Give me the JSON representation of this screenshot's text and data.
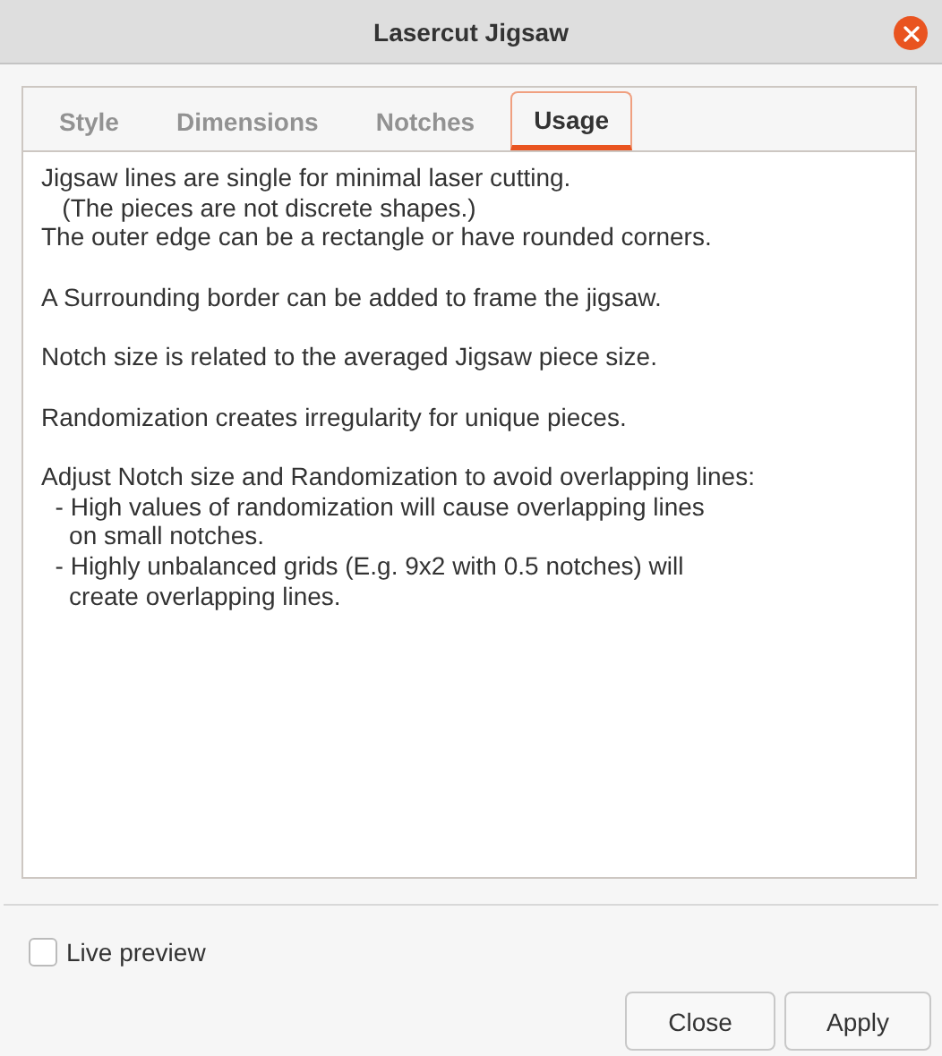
{
  "window": {
    "title": "Lasercut Jigsaw"
  },
  "tabs": [
    {
      "label": "Style",
      "selected": false
    },
    {
      "label": "Dimensions",
      "selected": false
    },
    {
      "label": "Notches",
      "selected": false
    },
    {
      "label": "Usage",
      "selected": true
    }
  ],
  "usage_text": [
    [
      "Jigsaw lines are single for minimal laser cutting.",
      "   (The pieces are not discrete shapes.)",
      "The outer edge can be a rectangle or have rounded corners."
    ],
    [
      "A Surrounding border can be added to frame the jigsaw."
    ],
    [
      "Notch size is related to the averaged Jigsaw piece size."
    ],
    [
      "Randomization creates irregularity for unique pieces."
    ],
    [
      "Adjust Notch size and Randomization to avoid overlapping lines:",
      "  - High values of randomization will cause overlapping lines",
      "    on small notches.",
      "  - Highly unbalanced grids (E.g. 9x2 with 0.5 notches) will",
      "    create overlapping lines."
    ]
  ],
  "live_preview": {
    "label": "Live preview",
    "checked": false
  },
  "buttons": [
    "Close",
    "Apply"
  ]
}
